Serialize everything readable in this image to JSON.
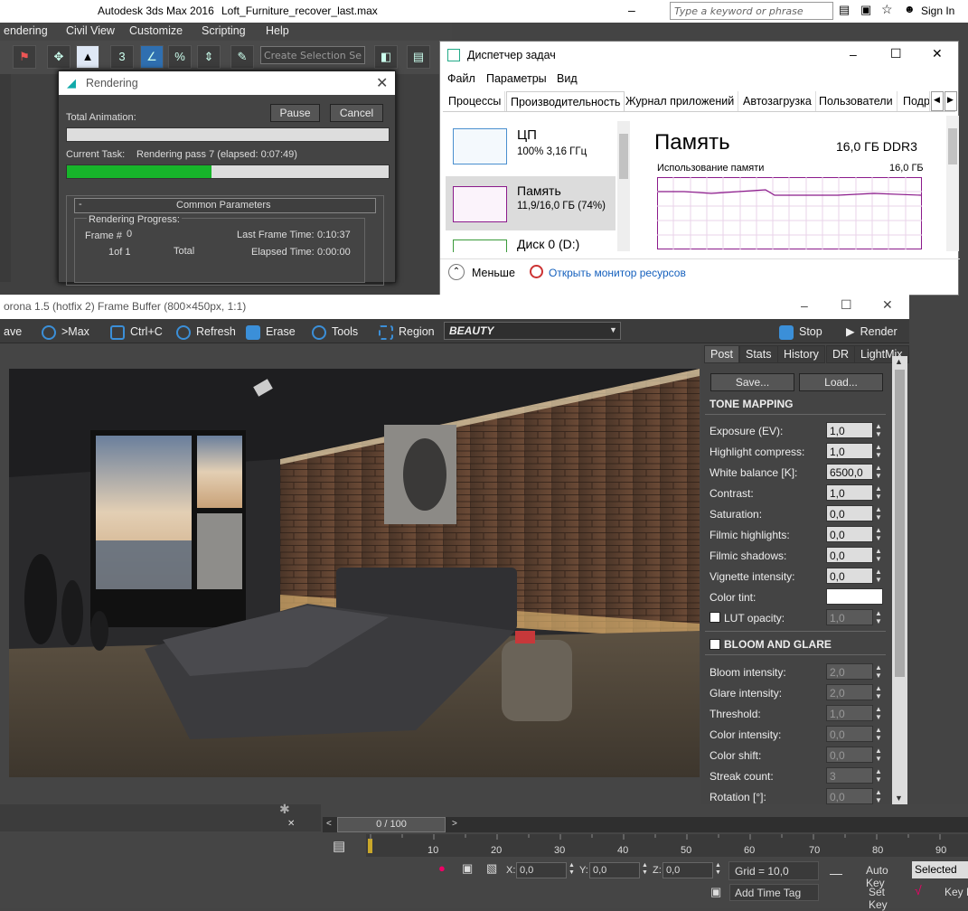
{
  "app": {
    "title": "Autodesk 3ds Max 2016",
    "file": "Loft_Furniture_recover_last.max",
    "search_placeholder": "Type a keyword or phrase",
    "sign_in": "Sign In"
  },
  "menu": [
    "endering",
    "Civil View",
    "Customize",
    "Scripting",
    "Help"
  ],
  "toolbar": {
    "selection_set": "Create Selection Se"
  },
  "rendering_dialog": {
    "title": "Rendering",
    "total_animation_label": "Total Animation:",
    "pause": "Pause",
    "cancel": "Cancel",
    "current_task_label": "Current Task:",
    "current_task_value": "Rendering pass 7 (elapsed: 0:07:49)",
    "progress": 0.45,
    "common_params": "Common Parameters",
    "rendering_progress": "Rendering Progress:",
    "frame_label": "Frame #",
    "frame_value": "0",
    "frame_of": "1of 1",
    "total": "Total",
    "last_frame_time_label": "Last Frame Time:",
    "last_frame_time": "0:10:37",
    "elapsed_time_label": "Elapsed Time:",
    "elapsed_time": "0:00:00"
  },
  "task_manager": {
    "title": "Диспетчер задач",
    "menu": [
      "Файл",
      "Параметры",
      "Вид"
    ],
    "tabs": [
      "Процессы",
      "Производительность",
      "Журнал приложений",
      "Автозагрузка",
      "Пользователи",
      "Подр"
    ],
    "items": [
      {
        "name": "ЦП",
        "detail": "100% 3,16 ГГц"
      },
      {
        "name": "Память",
        "detail": "11,9/16,0 ГБ (74%)"
      },
      {
        "name": "Диск 0 (D:)",
        "detail": ""
      }
    ],
    "memory_title": "Память",
    "memory_total": "16,0 ГБ DDR3",
    "usage_label": "Использование памяти",
    "usage_max": "16,0 ГБ",
    "fewer": "Меньше",
    "resource_monitor": "Открыть монитор ресурсов"
  },
  "frame_buffer": {
    "title": "orona 1.5 (hotfix 2) Frame Buffer (800×450px, 1:1)",
    "tools": [
      "ave",
      ">Max",
      "Ctrl+C",
      "Refresh",
      "Erase",
      "Tools",
      "Region"
    ],
    "channel": "BEAUTY",
    "stop": "Stop",
    "render": "Render",
    "tabs": [
      "Post",
      "Stats",
      "History",
      "DR",
      "LightMix"
    ],
    "save": "Save...",
    "load": "Load...",
    "tone_mapping": "TONE MAPPING",
    "tone_params": [
      {
        "label": "Exposure (EV):",
        "value": "1,0"
      },
      {
        "label": "Highlight compress:",
        "value": "1,0"
      },
      {
        "label": "White balance [K]:",
        "value": "6500,0"
      },
      {
        "label": "Contrast:",
        "value": "1,0"
      },
      {
        "label": "Saturation:",
        "value": "0,0"
      },
      {
        "label": "Filmic highlights:",
        "value": "0,0"
      },
      {
        "label": "Filmic shadows:",
        "value": "0,0"
      },
      {
        "label": "Vignette intensity:",
        "value": "0,0"
      }
    ],
    "color_tint": "Color tint:",
    "lut_opacity": {
      "label": "LUT opacity:",
      "value": "1,0"
    },
    "bloom_glare": "BLOOM AND GLARE",
    "bloom_params": [
      {
        "label": "Bloom intensity:",
        "value": "2,0"
      },
      {
        "label": "Glare intensity:",
        "value": "2,0"
      },
      {
        "label": "Threshold:",
        "value": "1,0"
      },
      {
        "label": "Color intensity:",
        "value": "0,0"
      },
      {
        "label": "Color shift:",
        "value": "0,0"
      },
      {
        "label": "Streak count:",
        "value": "3"
      },
      {
        "label": "Rotation [°]:",
        "value": "0,0"
      }
    ]
  },
  "timeline": {
    "frame_counter": "0 / 100",
    "ticks": [
      "10",
      "20",
      "30",
      "40",
      "50",
      "60",
      "70",
      "80",
      "90"
    ],
    "x_label": "X:",
    "x": "0,0",
    "y_label": "Y:",
    "y": "0,0",
    "z_label": "Z:",
    "z": "0,0",
    "grid": "Grid = 10,0",
    "auto_key": "Auto Key",
    "selected": "Selected",
    "set_key": "Set Key",
    "key_filters": "Key F",
    "add_time_tag": "Add Time Tag"
  },
  "colors": {
    "accent_blue": "#3b8fd8",
    "progress_green": "#17b52a",
    "memory_purple": "#8b1a8b"
  }
}
